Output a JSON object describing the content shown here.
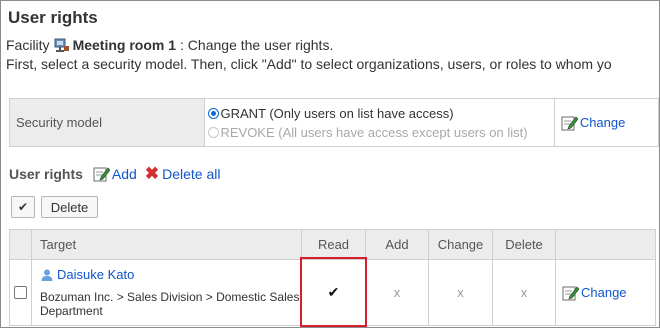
{
  "page": {
    "title": "User rights",
    "facility_label": "Facility",
    "facility_name": "Meeting room 1",
    "facility_suffix": ": Change the user rights.",
    "instruction": "First, select a security model. Then, click \"Add\" to select organizations, users, or roles to whom yo"
  },
  "security_model": {
    "label": "Security model",
    "options": [
      {
        "text": "GRANT (Only users on list have access)",
        "selected": true
      },
      {
        "text": "REVOKE (All users have access except users on list)",
        "selected": false
      }
    ],
    "change_label": "Change"
  },
  "user_rights": {
    "title": "User rights",
    "add_label": "Add",
    "delete_all_label": "Delete all",
    "check_button": "✔",
    "delete_button": "Delete"
  },
  "table": {
    "headers": [
      "Target",
      "Read",
      "Add",
      "Change",
      "Delete"
    ],
    "rows": [
      {
        "name": "Daisuke Kato",
        "path": "Bozuman Inc. > Sales Division > Domestic Sales Department",
        "read": "✔",
        "add": "x",
        "change": "x",
        "delete": "x",
        "change_link": "Change"
      }
    ]
  },
  "colors": {
    "link": "#1155cc",
    "radio_selected": "#0a6ad8",
    "highlight": "#d4202a",
    "header_bg": "#ececec"
  },
  "icons": [
    "facility-icon",
    "pencil-icon",
    "add-icon",
    "delete-x-icon",
    "user-icon",
    "check-icon"
  ]
}
